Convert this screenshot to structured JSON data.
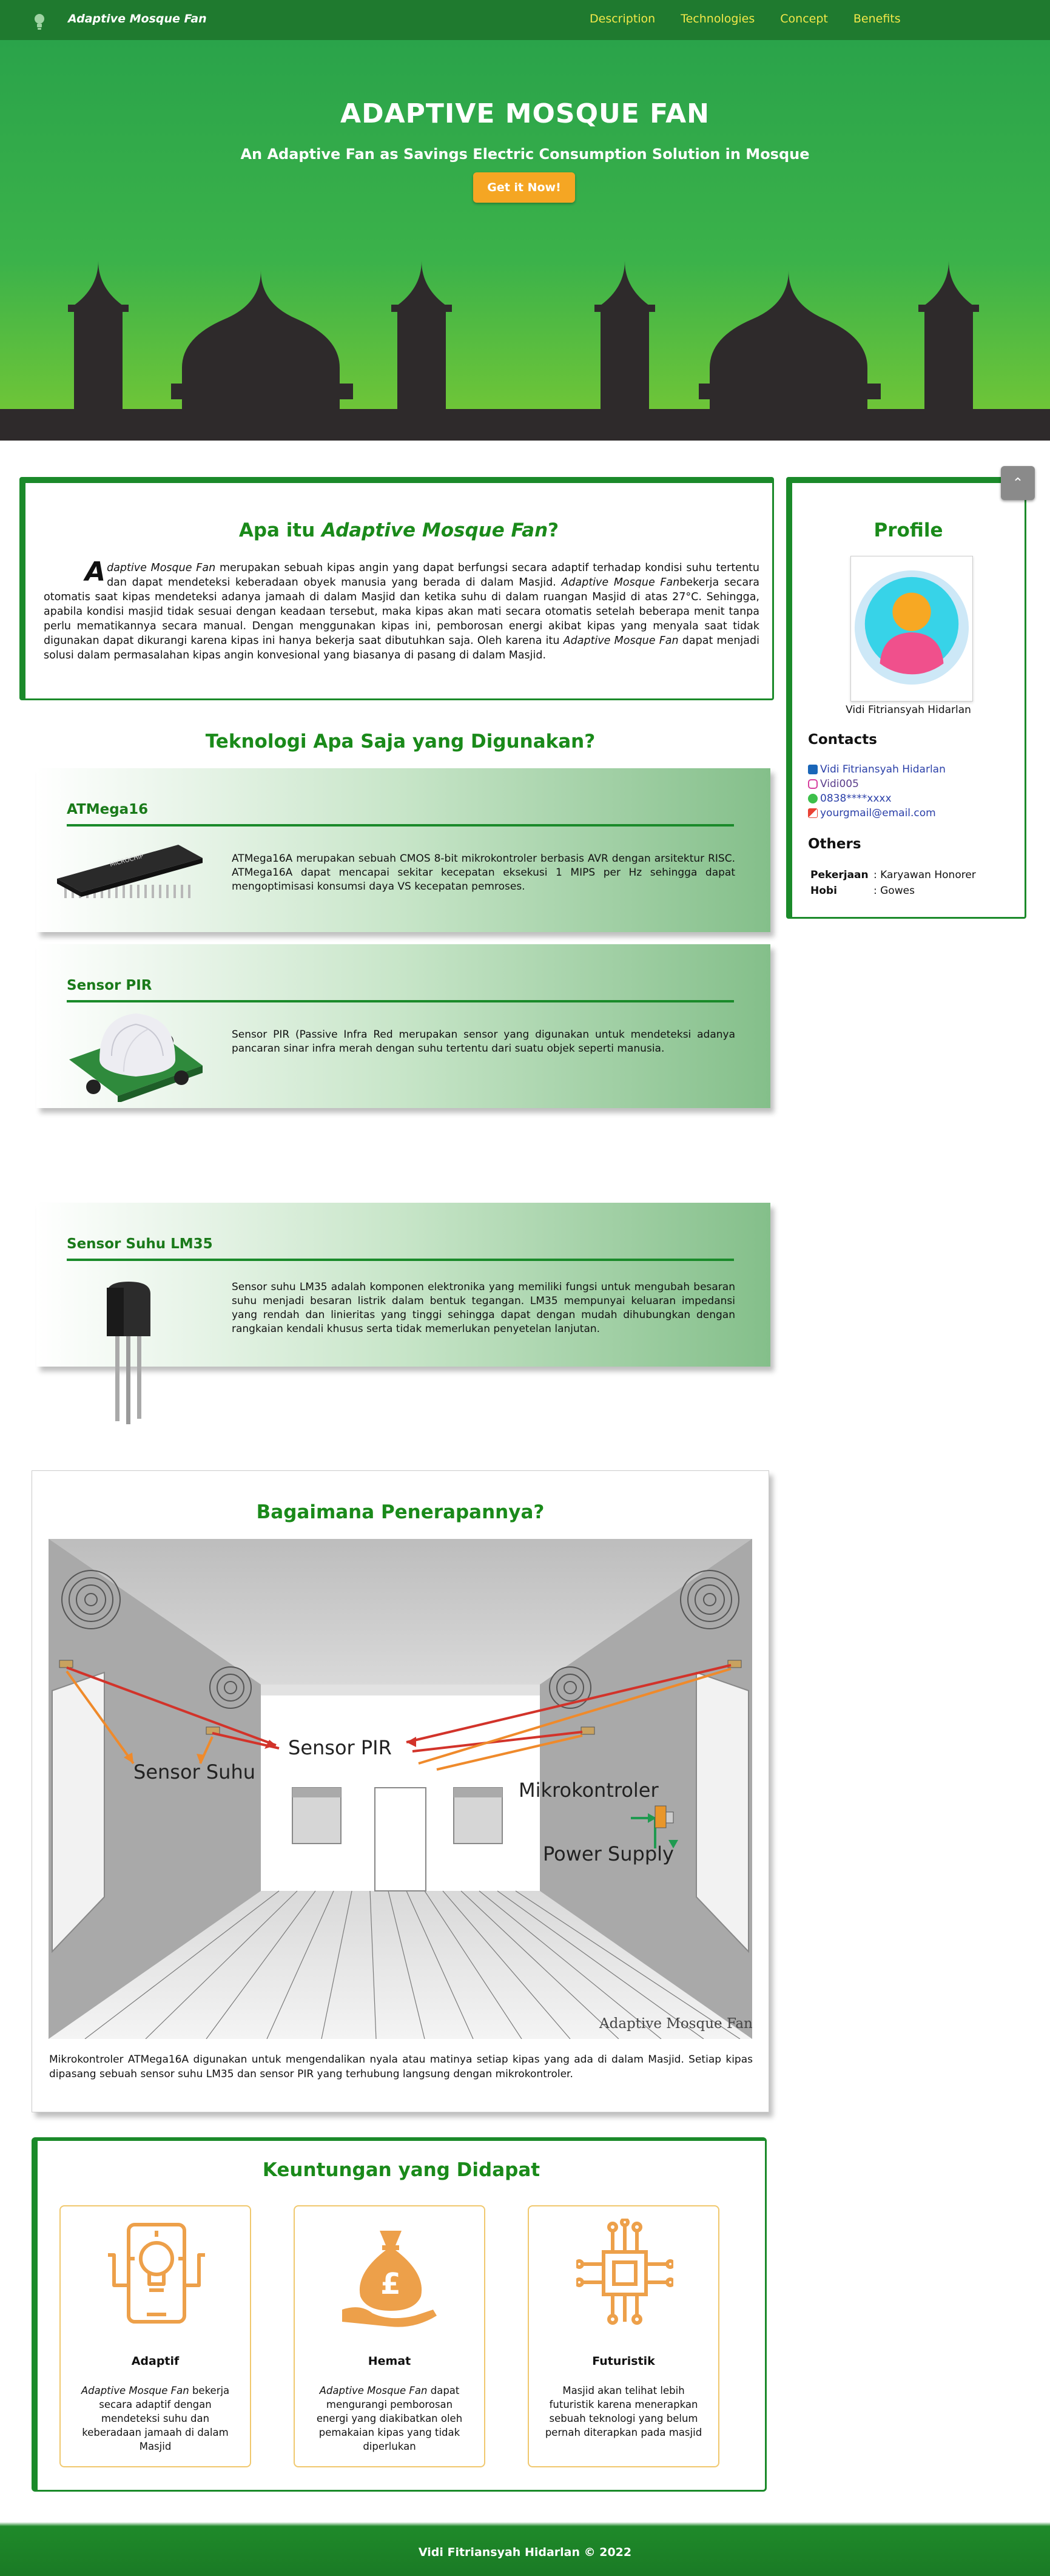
{
  "nav": {
    "brand": "Adaptive Mosque Fan",
    "links": [
      "Description",
      "Technologies",
      "Concept",
      "Benefits"
    ]
  },
  "hero": {
    "title": "ADAPTIVE MOSQUE FAN",
    "subtitle": "An Adaptive Fan as Savings Electric Consumption Solution in Mosque",
    "cta": "Get it Now!"
  },
  "about": {
    "title_plain": "Apa itu ",
    "title_italic": "Adaptive Mosque Fan",
    "title_end": "?",
    "dropcap": "A",
    "p1_italic": "daptive Mosque Fan",
    "p1": " merupakan sebuah kipas angin yang dapat berfungsi secara adaptif terhadap kondisi suhu tertentu dan dapat mendeteksi keberadaan obyek manusia yang berada di dalam Masjid. ",
    "p2_italic": "Adaptive Mosque Fan",
    "p2": "bekerja secara otomatis saat kipas mendeteksi adanya jamaah di dalam Masjid dan ketika suhu di dalam ruangan Masjid di atas 27°C. Sehingga, apabila kondisi masjid tidak sesuai dengan keadaan tersebut, maka kipas akan mati secara otomatis setelah beberapa menit tanpa perlu mematikannya secara manual. Dengan menggunakan kipas ini, pemborosan energi akibat kipas yang menyala saat tidak digunakan dapat dikurangi karena kipas ini hanya bekerja saat dibutuhkan saja. Oleh karena itu ",
    "p3_italic": "Adaptive Mosque Fan",
    "p3": " dapat menjadi solusi dalam permasalahan kipas angin konvesional yang biasanya di pasang di dalam Masjid."
  },
  "profile": {
    "title": "Profile",
    "name": "Vidi Fitriansyah Hidarlan",
    "contacts_title": "Contacts",
    "contacts": [
      "Vidi Fitriansyah Hidarlan",
      "Vidi005",
      "0838****xxxx",
      "yourgmail@email.com"
    ],
    "others_title": "Others",
    "job_label": "Pekerjaan",
    "job": ": Karyawan Honorer",
    "hobby_label": "Hobi",
    "hobby": ": Gowes"
  },
  "tech": {
    "title": "Teknologi Apa Saja yang Digunakan?",
    "items": [
      {
        "name": "ATMega16",
        "desc": "ATMega16A merupakan sebuah CMOS 8-bit mikrokontroler berbasis AVR dengan arsitektur RISC. ATMega16A dapat mencapai sekitar kecepatan eksekusi 1 MIPS per Hz sehingga dapat mengoptimisasi konsumsi daya VS kecepatan pemroses."
      },
      {
        "name": "Sensor PIR",
        "desc": "Sensor PIR (Passive Infra Red merupakan sensor yang digunakan untuk mendeteksi adanya pancaran sinar infra merah dengan suhu tertentu dari suatu objek seperti manusia."
      },
      {
        "name": "Sensor Suhu LM35",
        "desc": "Sensor suhu LM35 adalah komponen elektronika yang memiliki fungsi untuk mengubah besaran suhu menjadi besaran listrik dalam bentuk tegangan. LM35 mempunyai keluaran impedansi yang rendah dan linieritas yang tinggi sehingga dapat dengan mudah dihubungkan dengan rangkaian kendali khusus serta tidak memerlukan penyetelan lanjutan."
      }
    ],
    "chip_label": "MICROCHIP"
  },
  "impl": {
    "title": "Bagaimana Penerapannya?",
    "labels": {
      "pir": "Sensor PIR",
      "suhu": "Sensor Suhu",
      "mikro": "Mikrokontroler",
      "power": "Power Supply",
      "watermark": "Adaptive Mosque Fan"
    },
    "desc": "Mikrokontroler ATMega16A digunakan untuk mengendalikan nyala atau matinya setiap kipas yang ada di dalam Masjid. Setiap kipas dipasang sebuah sensor suhu LM35 dan sensor PIR yang terhubung langsung dengan mikrokontroler."
  },
  "benefits": {
    "title": "Keuntungan yang Didapat",
    "items": [
      {
        "name": "Adaptif",
        "desc_italic": "Adaptive Mosque Fan",
        "desc": " bekerja secara adaptif dengan mendeteksi suhu dan keberadaan jamaah di dalam Masjid"
      },
      {
        "name": "Hemat",
        "desc_italic": "Adaptive Mosque Fan",
        "desc": " dapat mengurangi pemborosan energi yang diakibatkan oleh pemakaian kipas yang tidak diperlukan"
      },
      {
        "name": "Futuristik",
        "desc_italic": "",
        "desc": "Masjid akan telihat lebih futuristik karena menerapkan sebuah teknologi yang belum pernah diterapkan pada masjid"
      }
    ],
    "coin_symbol": "£"
  },
  "footer": {
    "text": "Vidi Fitriansyah Hidarlan © 2022"
  },
  "colors": {
    "nav": "#1f7a2f",
    "accent": "#1a8a1a",
    "link": "#f2e84a",
    "cta": "#f5a623",
    "benefit_icon": "#eda04a"
  },
  "icons": [
    "lightbulb-icon",
    "arrow-up-icon",
    "linkedin-icon",
    "instagram-icon",
    "whatsapp-icon",
    "gmail-icon",
    "bulb-hand-icon",
    "money-bag-icon",
    "circuit-icon"
  ]
}
